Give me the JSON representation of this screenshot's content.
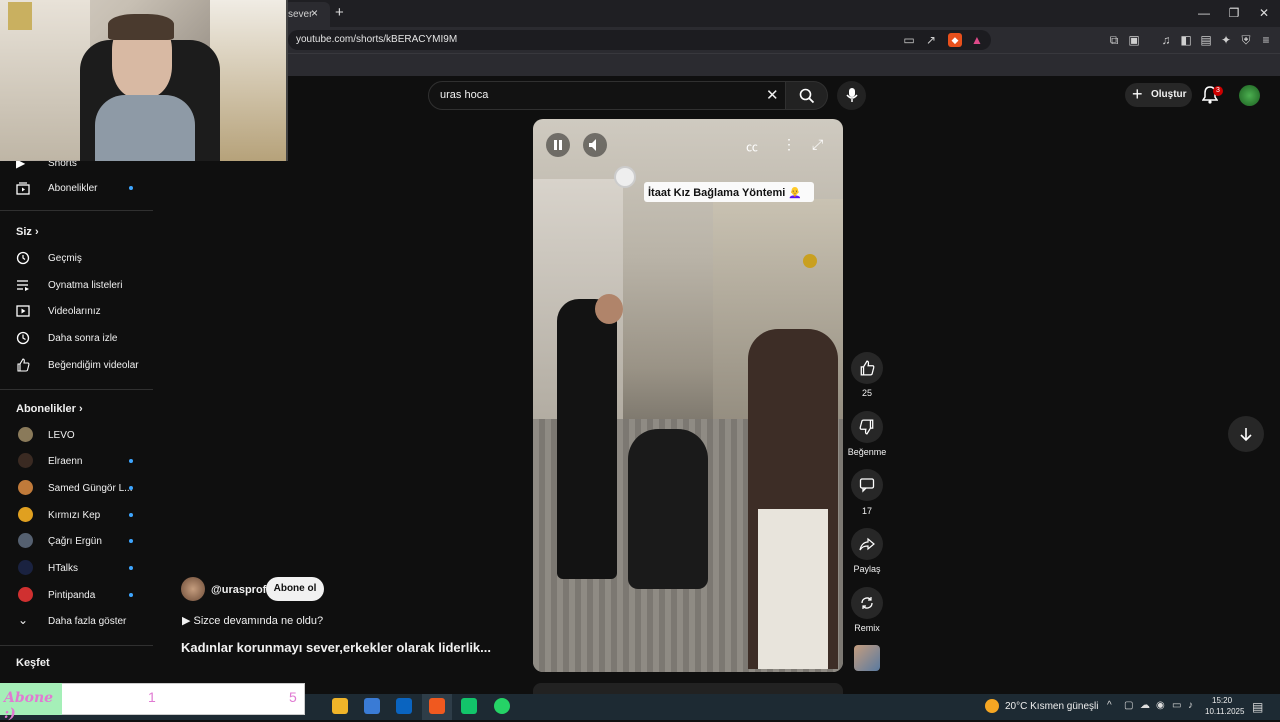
{
  "browser": {
    "tab_title": "sever",
    "tab_close": "×",
    "new_tab": "+",
    "url": "youtube.com/shorts/kBERACYMI9M",
    "window_controls": [
      "—",
      "❐",
      "✕"
    ]
  },
  "youtube": {
    "search": {
      "value": "uras hoca"
    },
    "create_label": "Oluştur",
    "notifications_count": "3"
  },
  "sidebar": {
    "top_items": [
      {
        "label": "Shorts",
        "icon": "shorts-icon"
      },
      {
        "label": "Abonelikler",
        "icon": "subscriptions-icon",
        "dot": true
      }
    ],
    "you_header": "Siz",
    "you_items": [
      {
        "label": "Geçmiş",
        "icon": "history-icon"
      },
      {
        "label": "Oynatma listeleri",
        "icon": "playlist-icon"
      },
      {
        "label": "Videolarınız",
        "icon": "your-videos-icon"
      },
      {
        "label": "Daha sonra izle",
        "icon": "watch-later-icon"
      },
      {
        "label": "Beğendiğim videolar",
        "icon": "liked-videos-icon"
      }
    ],
    "subs_header": "Abonelikler",
    "subs_items": [
      {
        "label": "LEVO",
        "color": "#8a7a5a",
        "dot": false
      },
      {
        "label": "Elraenn",
        "color": "#3a2a22",
        "dot": true
      },
      {
        "label": "Samed Güngör L...",
        "color": "#c07a3a",
        "dot": true
      },
      {
        "label": "Kırmızı Kep",
        "color": "#e0a020",
        "dot": true
      },
      {
        "label": "Çağrı Ergün",
        "color": "#556070",
        "dot": true
      },
      {
        "label": "HTalks",
        "color": "#1a2240",
        "dot": true
      },
      {
        "label": "Pintipanda",
        "color": "#d03030",
        "dot": true
      }
    ],
    "show_more": "Daha fazla göster",
    "explore_header": "Keşfet"
  },
  "short": {
    "overlay_title": "İtaat Kız Bağlama Yöntemi 👩‍🦲",
    "channel": "@urasprof",
    "subscribe_label": "Abone ol",
    "description": "▶ Sizce devamında ne oldu?",
    "title": "Kadınlar korunmayı sever,erkekler olarak liderlik...",
    "likes": "25",
    "dislike_label": "Beğenme",
    "comments": "17",
    "share_label": "Paylaş",
    "remix_label": "Remix"
  },
  "stream_widget": {
    "label": "Abone :)",
    "current": "1",
    "goal": "5"
  },
  "taskbar": {
    "weather": "20°C  Kısmen güneşli",
    "time": "15:20",
    "date": "10.11.2025"
  },
  "colors": {
    "accent_blue": "#3ea6ff",
    "badge_red": "#cc0000",
    "background": "#0f0f0f"
  }
}
